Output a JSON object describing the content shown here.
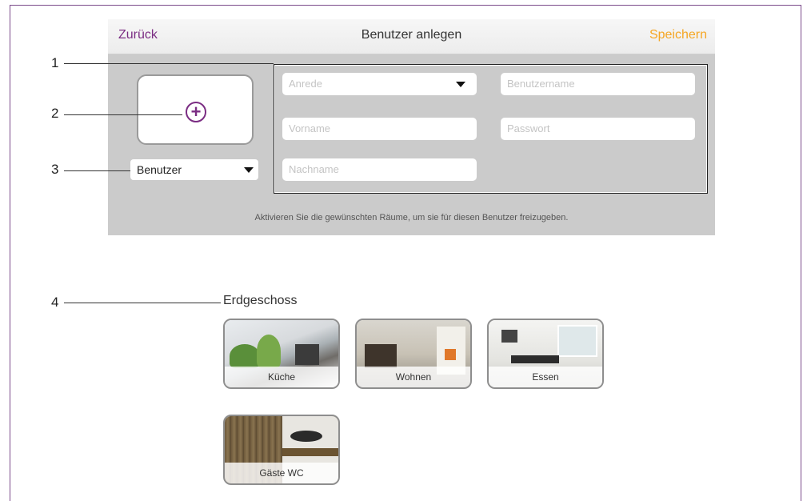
{
  "nav": {
    "back": "Zurück",
    "title": "Benutzer anlegen",
    "save": "Speichern"
  },
  "form": {
    "anrede_placeholder": "Anrede",
    "vorname_placeholder": "Vorname",
    "nachname_placeholder": "Nachname",
    "benutzername_placeholder": "Benutzername",
    "passwort_placeholder": "Passwort",
    "role_value": "Benutzer",
    "hint": "Aktivieren Sie die gewünschten Räume, um sie für diesen Benutzer freizugeben."
  },
  "photo": {
    "icon": "plus-circle-icon",
    "glyph": "+"
  },
  "callouts": [
    "1",
    "2",
    "3",
    "4"
  ],
  "floor": {
    "title": "Erdgeschoss",
    "rooms": [
      {
        "label": "Küche"
      },
      {
        "label": "Wohnen"
      },
      {
        "label": "Essen"
      },
      {
        "label": "Gäste WC"
      }
    ]
  },
  "colors": {
    "accent": "#7b2d83",
    "save": "#f5a623",
    "panel": "#cbcbcb"
  }
}
